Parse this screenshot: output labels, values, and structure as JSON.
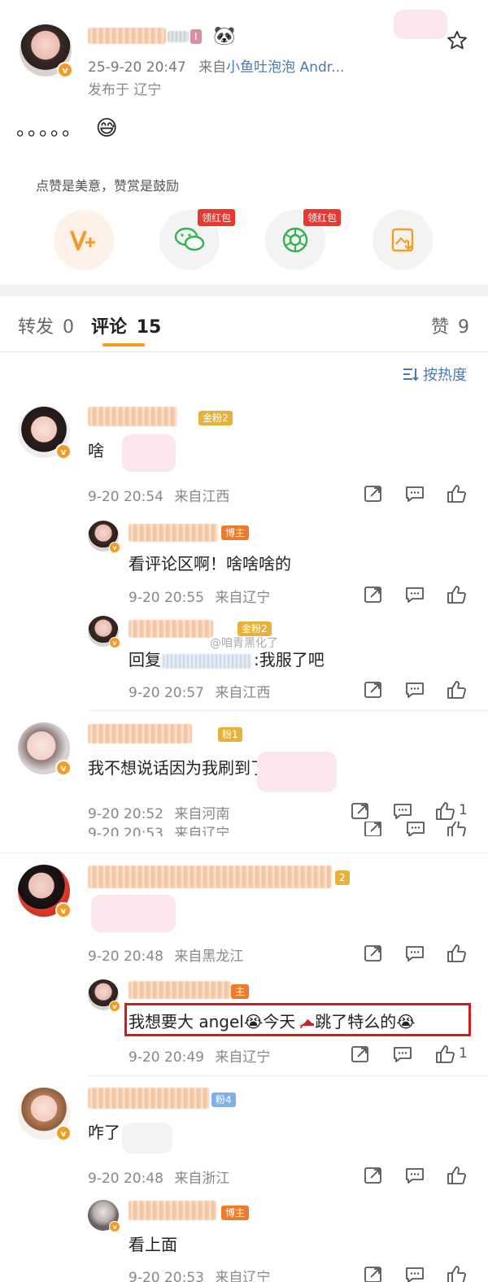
{
  "post": {
    "timestamp": "25-9-20 20:47",
    "source_prefix": "来自",
    "source_app": "小鱼吐泡泡 Andr...",
    "location": "发布于 辽宁",
    "content": "。。。。。",
    "content_emoji": "😅",
    "support_hint": "点赞是美意，赞赏是鼓励",
    "redpacket_label": "领红包",
    "redpacket_label_2": "领红包",
    "level_badge": "I"
  },
  "tabs": {
    "repost_label": "转发",
    "repost_count": "0",
    "comment_label": "评论",
    "comment_count": "15",
    "like_label": "赞",
    "like_count": "9",
    "sort_label": "按热度"
  },
  "comments": [
    {
      "badge": "金粉2",
      "text": "啥",
      "time": "9-20 20:54",
      "loc": "来自江西",
      "replies": [
        {
          "badge": "博主",
          "text": "看评论区啊！啥啥啥的",
          "time": "9-20 20:55",
          "loc": "来自辽宁"
        },
        {
          "badge": "金粉2",
          "text_prefix": "回复",
          "text_suffix": ":我服了吧",
          "watermark": "@咱青黑化了",
          "time": "9-20 20:57",
          "loc": "来自江西"
        }
      ]
    },
    {
      "badge": "粉1",
      "text": "我不想说话因为我刷到了",
      "time": "9-20 20:52",
      "loc": "来自河南",
      "likes": "1",
      "ghost_time": "9-20 20:53",
      "ghost_loc": "来自辽宁"
    },
    {
      "badge": "2",
      "time": "9-20 20:48",
      "loc": "来自黑龙江",
      "replies": [
        {
          "badge": "主",
          "text_a": "我想要大 angel",
          "text_b": "今天",
          "text_c": "跳了特么的",
          "emoji": "😭",
          "time": "9-20 20:49",
          "loc": "来自辽宁",
          "likes": "1"
        }
      ]
    },
    {
      "badge": "粉4",
      "text": "咋了",
      "time": "9-20 20:48",
      "loc": "来自浙江",
      "replies": [
        {
          "badge": "博主",
          "text": "看上面",
          "time": "9-20 20:53",
          "loc": "来自辽宁"
        }
      ]
    }
  ],
  "colors": {
    "orange": "#f59a23",
    "red": "#e8382f",
    "highlight_border": "#d3191a",
    "blue": "#4a7bb0"
  }
}
